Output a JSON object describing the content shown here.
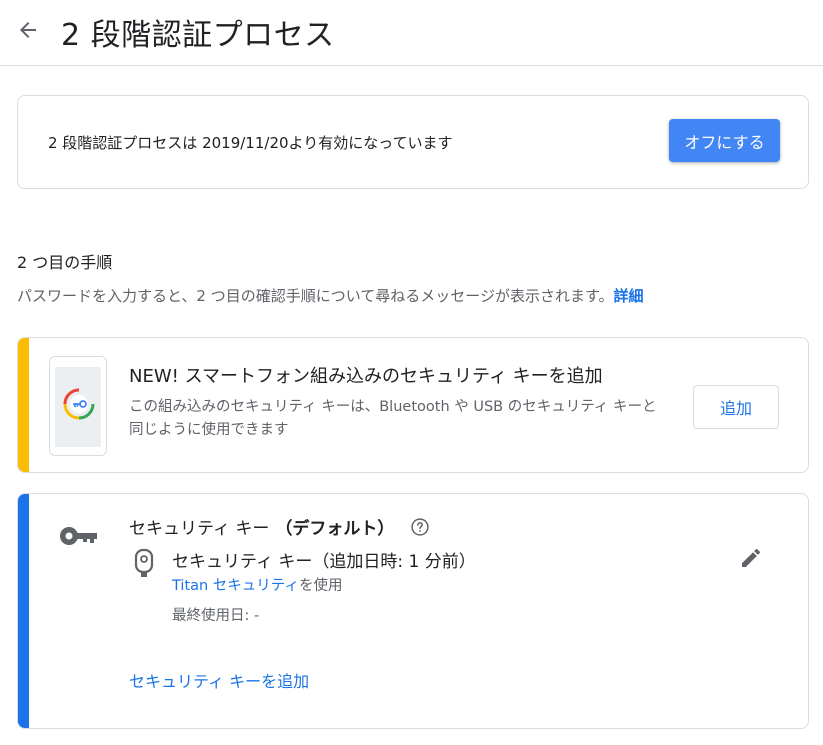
{
  "header": {
    "title": "2 段階認証プロセス",
    "back_icon": "arrow-back-icon"
  },
  "status": {
    "text": "2 段階認証プロセスは 2019/11/20より有効になっています",
    "off_button": "オフにする"
  },
  "second_step": {
    "heading": "2 つ目の手順",
    "description": "パスワードを入力すると、2 つ目の確認手順について尋ねるメッセージが表示されます。",
    "detail_link": "詳細"
  },
  "promo": {
    "accent_color": "#fbbc04",
    "title": "NEW! スマートフォン組み込みのセキュリティ キーを追加",
    "description": "この組み込みのセキュリティ キーは、Bluetooth や USB のセキュリティ キーと同じように使用できます",
    "add_button": "追加"
  },
  "security_key": {
    "accent_color": "#1a73e8",
    "heading": "セキュリティ キー",
    "heading_default": "（デフォルト）",
    "key_name": "セキュリティ キー（追加日時: 1 分前）",
    "provider_link": "Titan セキュリティ",
    "provider_suffix": "を使用",
    "last_used": "最終使用日: -",
    "add_key_link": "セキュリティ キーを追加"
  }
}
